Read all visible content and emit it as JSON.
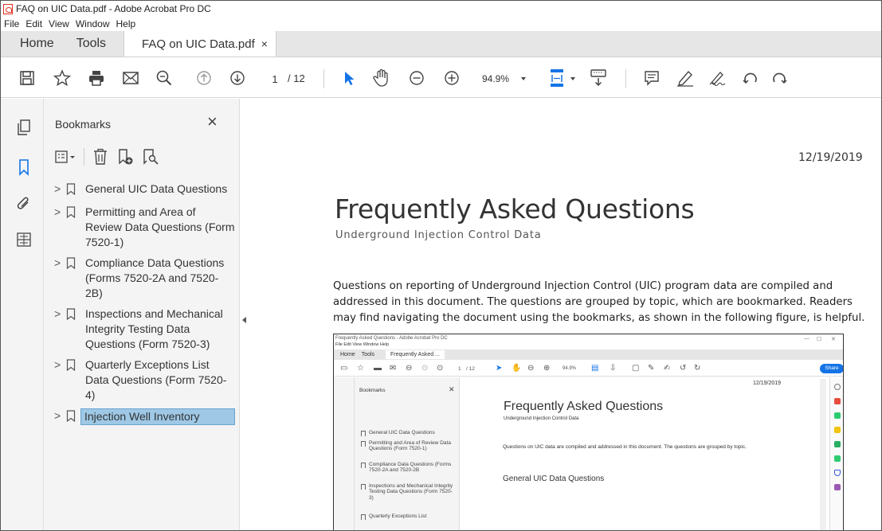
{
  "window": {
    "title": "FAQ on UIC Data.pdf - Adobe Acrobat Pro DC"
  },
  "menu": [
    "File",
    "Edit",
    "View",
    "Window",
    "Help"
  ],
  "tabs": {
    "home": "Home",
    "tools": "Tools",
    "document": "FAQ on UIC Data.pdf",
    "close": "×"
  },
  "toolbar": {
    "page_current": "1",
    "page_total": "/ 12",
    "zoom": "94.9%"
  },
  "bookmarks_panel": {
    "title": "Bookmarks",
    "close": "×",
    "items": [
      {
        "label": "General UIC Data Questions",
        "selected": false
      },
      {
        "label": "Permitting and Area of Review Data Questions (Form 7520-1)",
        "selected": false
      },
      {
        "label": "Compliance Data Questions (Forms 7520-2A and 7520-2B)",
        "selected": false
      },
      {
        "label": "Inspections and Mechanical Integrity Testing Data Questions (Form 7520-3)",
        "selected": false
      },
      {
        "label": "Quarterly Exceptions List Data Questions (Form 7520-4)",
        "selected": false
      },
      {
        "label": "Injection Well Inventory",
        "selected": true
      }
    ]
  },
  "document": {
    "date": "12/19/2019",
    "heading": "Frequently Asked Questions",
    "subheading": "Underground Injection Control Data",
    "paragraph": "Questions on reporting of Underground Injection Control (UIC) program data are compiled and addressed in this document. The questions are grouped by topic, which are bookmarked. Readers may find navigating the document using the bookmarks, as shown in the following figure, is helpful."
  },
  "figure": {
    "title": "Frequently Asked Questions - Adobe Acrobat Pro DC",
    "menu": "File  Edit  View  Window  Help",
    "tab_home": "Home",
    "tab_tools": "Tools",
    "tab_doc": "Frequently Asked ...",
    "page": "1",
    "page_total": "/ 12",
    "zoom": "94.9%",
    "share": "Share",
    "bookmarks_title": "Bookmarks",
    "bookmarks": [
      "General UIC Data Questions",
      "Permitting and Area of Review Data Questions (Form 7520-1)",
      "Compliance Data Questions (Forms 7520-2A and 7520-2B",
      "Inspections and Mechanical Integrity Testing Data Questions (Form 7520-3)",
      "Quarterly Exceptions List"
    ],
    "date": "12/19/2019",
    "heading": "Frequently Asked Questions",
    "subheading": "Underground Injection Control Data",
    "paragraph": "Questions on UIC data are compiled and addressed in this document. The questions are grouped by topic.",
    "section": "General UIC Data Questions"
  },
  "colors": {
    "accent": "#1473e6",
    "selection": "#9ec8e6",
    "pdf_red": "#d32f2f"
  }
}
